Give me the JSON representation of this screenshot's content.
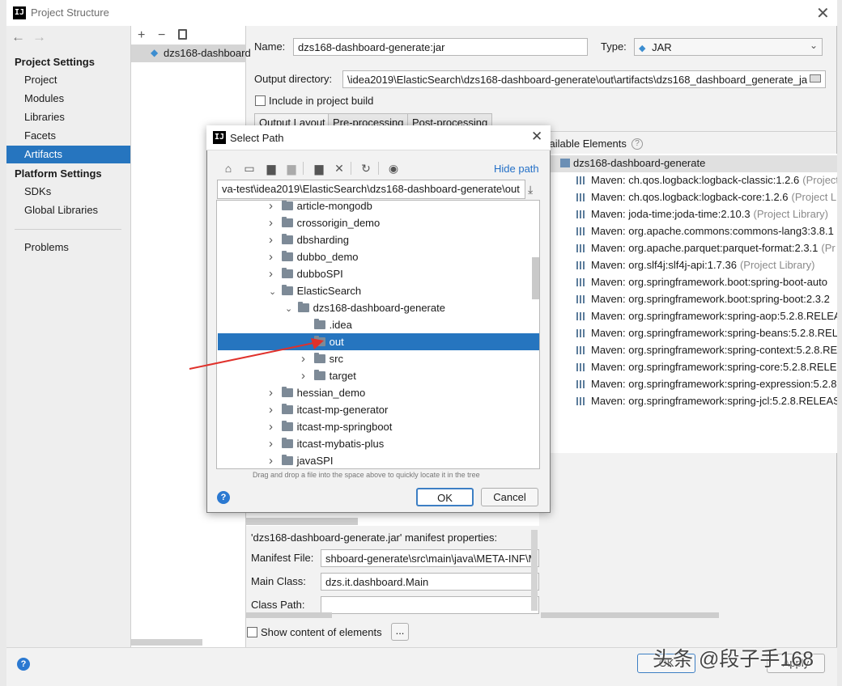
{
  "window": {
    "title": "Project Structure"
  },
  "leftnav": {
    "project_settings_header": "Project Settings",
    "project_settings": [
      "Project",
      "Modules",
      "Libraries",
      "Facets",
      "Artifacts"
    ],
    "platform_settings_header": "Platform Settings",
    "platform_settings": [
      "SDKs",
      "Global Libraries"
    ],
    "problems": "Problems",
    "selected": "Artifacts"
  },
  "artifact_list": {
    "item": "dzs168-dashboard"
  },
  "artifact": {
    "name_label": "Name:",
    "name_value": "dzs168-dashboard-generate:jar",
    "type_label": "Type:",
    "type_value": "JAR",
    "output_dir_label": "Output directory:",
    "output_dir_value": "\\idea2019\\ElasticSearch\\dzs168-dashboard-generate\\out\\artifacts\\dzs168_dashboard_generate_ja",
    "include_in_build": "Include in project build",
    "tabs": [
      "Output Layout",
      "Pre-processing",
      "Post-processing"
    ],
    "available_elements_title": "vailable Elements",
    "module_root": "dzs168-dashboard-generate",
    "libraries": [
      {
        "name": "Maven: ch.qos.logback:logback-classic:1.2.6",
        "note": "(Project"
      },
      {
        "name": "Maven: ch.qos.logback:logback-core:1.2.6",
        "note": "(Project L"
      },
      {
        "name": "Maven: joda-time:joda-time:2.10.3",
        "note": "(Project Library)"
      },
      {
        "name": "Maven: org.apache.commons:commons-lang3:3.8.1",
        "note": ""
      },
      {
        "name": "Maven: org.apache.parquet:parquet-format:2.3.1",
        "note": "(Pr"
      },
      {
        "name": "Maven: org.slf4j:slf4j-api:1.7.36",
        "note": "(Project Library)"
      },
      {
        "name": "Maven: org.springframework.boot:spring-boot-auto",
        "note": ""
      },
      {
        "name": "Maven: org.springframework.boot:spring-boot:2.3.2",
        "note": ""
      },
      {
        "name": "Maven: org.springframework:spring-aop:5.2.8.RELEA",
        "note": ""
      },
      {
        "name": "Maven: org.springframework:spring-beans:5.2.8.REL",
        "note": ""
      },
      {
        "name": "Maven: org.springframework:spring-context:5.2.8.RE",
        "note": ""
      },
      {
        "name": "Maven: org.springframework:spring-core:5.2.8.RELE",
        "note": ""
      },
      {
        "name": "Maven: org.springframework:spring-expression:5.2.8",
        "note": ""
      },
      {
        "name": "Maven: org.springframework:spring-jcl:5.2.8.RELEAS",
        "note": ""
      }
    ],
    "manifest_title": "'dzs168-dashboard-generate.jar' manifest properties:",
    "manifest_file_label": "Manifest File:",
    "manifest_file_value": "shboard-generate\\src\\main\\java\\META-INF\\M",
    "main_class_label": "Main Class:",
    "main_class_value": "dzs.it.dashboard.Main",
    "class_path_label": "Class Path:",
    "class_path_value": "",
    "show_content": "Show content of elements",
    "more_button": "..."
  },
  "dialog": {
    "title": "Select Path",
    "hide_path": "Hide path",
    "path_value": "va-test\\idea2019\\ElasticSearch\\dzs168-dashboard-generate\\out",
    "tree": [
      {
        "label": "article-mongodb",
        "depth": 0,
        "expanded": false
      },
      {
        "label": "crossorigin_demo",
        "depth": 0,
        "expanded": false
      },
      {
        "label": "dbsharding",
        "depth": 0,
        "expanded": false
      },
      {
        "label": "dubbo_demo",
        "depth": 0,
        "expanded": false
      },
      {
        "label": "dubboSPI",
        "depth": 0,
        "expanded": false
      },
      {
        "label": "ElasticSearch",
        "depth": 0,
        "expanded": true
      },
      {
        "label": "dzs168-dashboard-generate",
        "depth": 1,
        "expanded": true
      },
      {
        "label": ".idea",
        "depth": 2,
        "expanded": null
      },
      {
        "label": "out",
        "depth": 2,
        "expanded": null,
        "selected": true
      },
      {
        "label": "src",
        "depth": 2,
        "expanded": false
      },
      {
        "label": "target",
        "depth": 2,
        "expanded": false
      },
      {
        "label": "hessian_demo",
        "depth": 0,
        "expanded": false
      },
      {
        "label": "itcast-mp-generator",
        "depth": 0,
        "expanded": false
      },
      {
        "label": "itcast-mp-springboot",
        "depth": 0,
        "expanded": false
      },
      {
        "label": "itcast-mybatis-plus",
        "depth": 0,
        "expanded": false
      },
      {
        "label": "javaSPI",
        "depth": 0,
        "expanded": false
      }
    ],
    "hint": "Drag and drop a file into the space above to quickly locate it in the tree",
    "ok": "OK",
    "cancel": "Cancel",
    "help": "?"
  },
  "footer": {
    "help": "?",
    "ok": "OK",
    "apply": "Apply",
    "watermark": "头条 @段子手168"
  },
  "colors": {
    "selection": "#2675bf",
    "link": "#2470c7",
    "arrow": "#e0312b"
  },
  "icons": [
    "back-arrow-icon",
    "forward-arrow-icon",
    "add-icon",
    "remove-icon",
    "copy-icon",
    "home-icon",
    "desktop-icon",
    "project-folder-icon",
    "module-folder-icon",
    "new-folder-icon",
    "delete-icon",
    "refresh-icon",
    "show-hidden-icon",
    "download-icon",
    "folder-browse-icon",
    "help-icon",
    "close-icon"
  ]
}
